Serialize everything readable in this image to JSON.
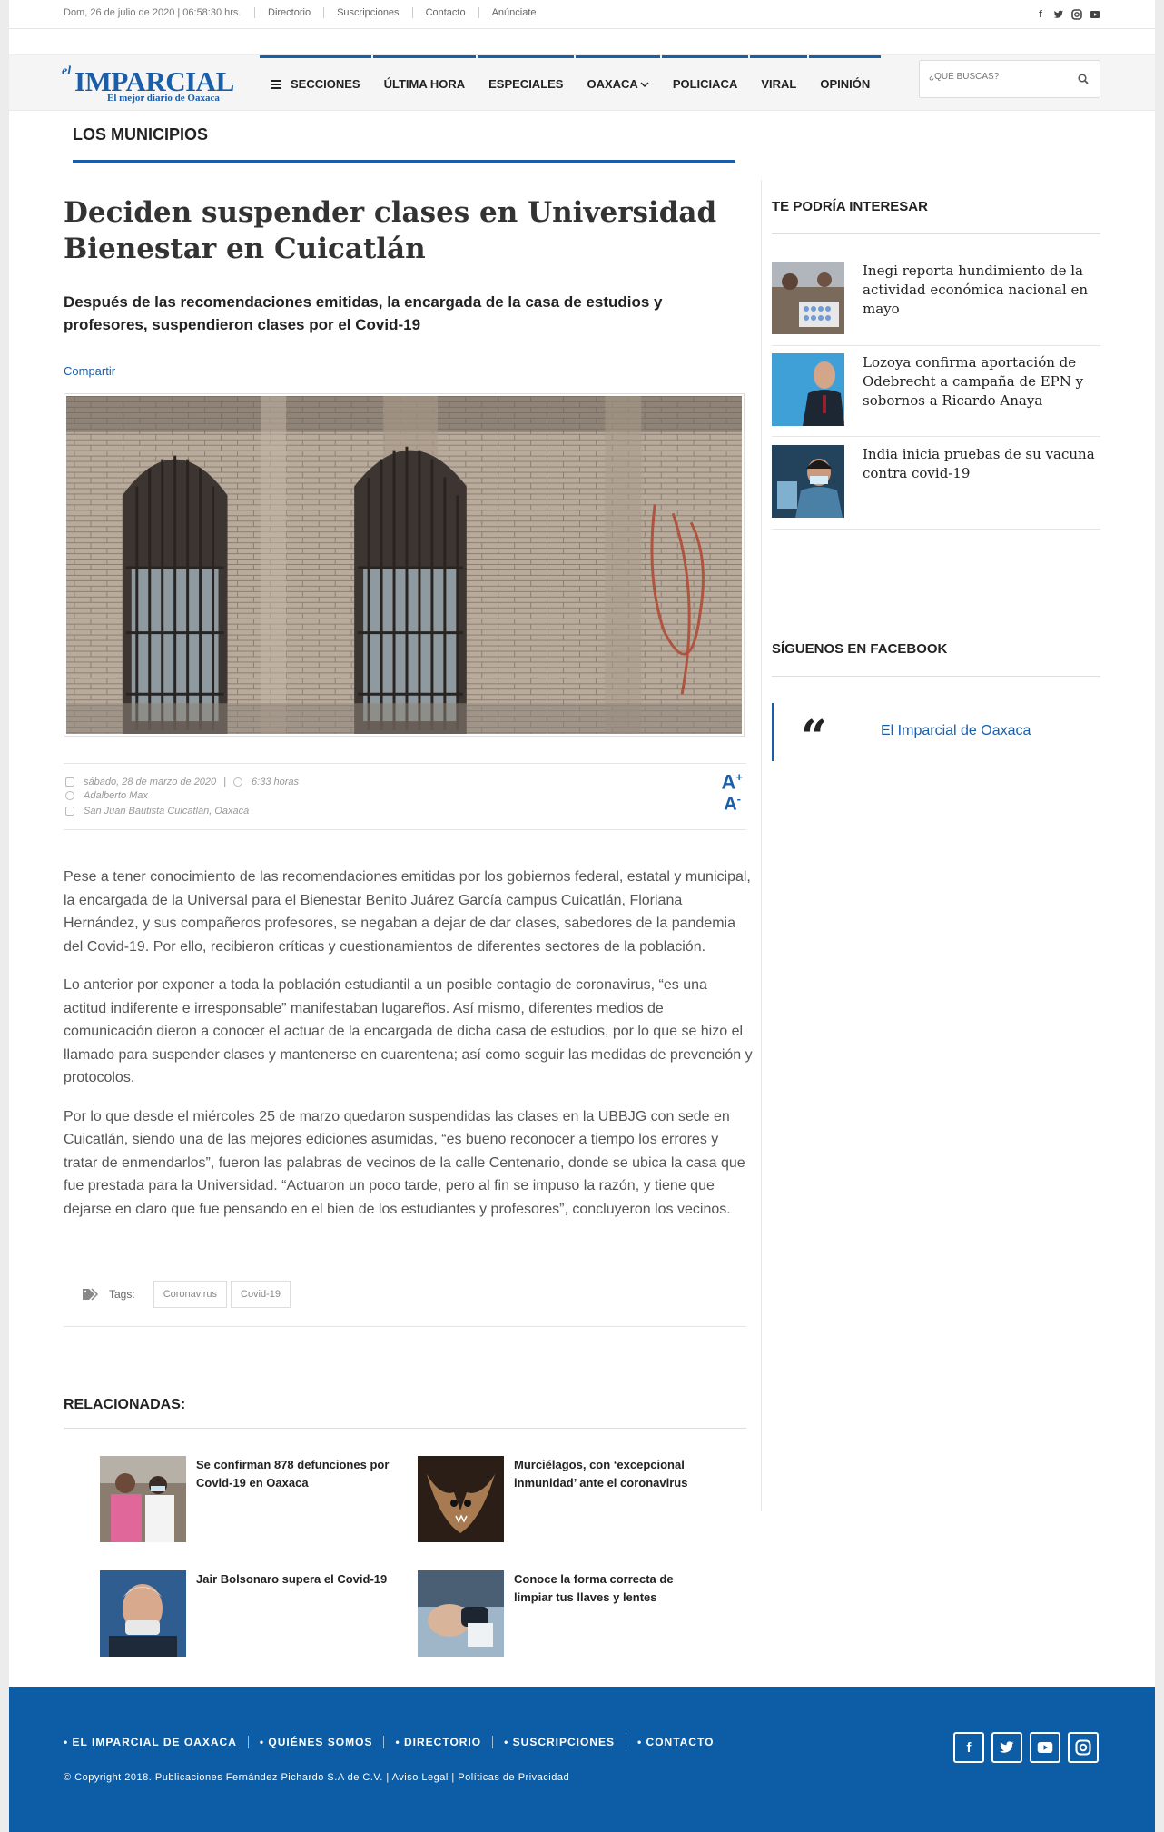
{
  "topbar": {
    "date": "Dom, 26 de julio de 2020 | 06:58:30 hrs.",
    "links": [
      "Directorio",
      "Suscripciones",
      "Contacto",
      "Anúnciate"
    ],
    "social": [
      "facebook-icon",
      "twitter-icon",
      "instagram-icon",
      "youtube-icon"
    ]
  },
  "header": {
    "logo_el": "el",
    "logo_name": "IMPARCIAL",
    "logo_tagline": "El mejor diario de Oaxaca",
    "nav": [
      "SECCIONES",
      "ÚLTIMA HORA",
      "ESPECIALES",
      "OAXACA",
      "POLICIACA",
      "VIRAL",
      "OPINIÓN"
    ],
    "search_placeholder": "¿QUÉ BUSCAS?"
  },
  "section": {
    "title": "LOS MUNICIPIOS"
  },
  "article": {
    "headline": "Deciden suspender clases en Universidad Bienestar en Cuicatlán",
    "subhead": "Después de las recomendaciones emitidas, la encargada de la casa de estudios y profesores, suspendieron clases por el Covid-19",
    "share": "Compartir",
    "date": "sábado, 28 de marzo de 2020",
    "time": "6:33 horas",
    "author": "Adalberto Max",
    "location": "San Juan Bautista Cuicatlán, Oaxaca",
    "font_up": "A",
    "font_down": "A",
    "paragraphs": [
      "Pese a tener conocimiento de las recomendaciones emitidas por los gobiernos federal, estatal y municipal, la encargada de la Universal para el Bienestar Benito Juárez García campus Cuicatlán, Floriana Hernández, y sus compañeros profesores, se negaban a dejar de dar clases, sabedores de la pandemia del Covid-19. Por ello, recibieron críticas y cuestionamientos de diferentes sectores de la población.",
      "Lo anterior por exponer a toda la población estudiantil a un posible contagio de coronavirus, “es una actitud indiferente e irresponsable” manifestaban lugareños. Así mismo, diferentes medios de comunicación dieron a conocer el actuar de la encargada de  dicha casa de estudios, por lo que se hizo el llamado para suspender clases y mantenerse en cuarentena; así como seguir las medidas de prevención y protocolos.",
      "Por lo que desde el miércoles 25 de marzo quedaron suspendidas las clases en la UBBJG con sede en Cuicatlán, siendo una de las mejores ediciones asumidas, “es bueno reconocer a tiempo los errores y tratar de enmendarlos”, fueron las palabras de vecinos de la calle Centenario, donde se ubica la casa que fue prestada para la Universidad. “Actuaron un poco tarde, pero al fin se impuso la razón, y tiene que dejarse en claro que fue pensando en el bien de los estudiantes y profesores”, concluyeron los vecinos."
    ],
    "tags_label": "Tags:",
    "tags": [
      "Coronavirus",
      "Covid-19"
    ]
  },
  "related": {
    "title": "RELACIONADAS:",
    "items": [
      "Se confirman 878 defunciones por Covid-19 en Oaxaca",
      "Murciélagos, con ‘excepcional inmunidad’ ante el coronavirus",
      "Jair Bolsonaro supera el Covid-19",
      "Conoce la forma correcta de limpiar tus llaves y lentes"
    ]
  },
  "sidebar": {
    "interest_title": "TE PODRÍA INTERESAR",
    "interest_items": [
      "Inegi reporta hundimiento de la actividad económica nacional en mayo",
      "Lozoya confirma aportación de Odebrecht a campaña de EPN y sobornos a Ricardo Anaya",
      "India inicia pruebas de su vacuna contra covid-19"
    ],
    "facebook_title": "SÍGUENOS EN FACEBOOK",
    "quote_mark": "“",
    "facebook_page": "El Imparcial de Oaxaca"
  },
  "footer": {
    "links": [
      "• EL IMPARCIAL DE OAXACA",
      "• QUIÉNES SOMOS",
      "• DIRECTORIO",
      "• SUSCRIPCIONES",
      "• CONTACTO"
    ],
    "copyright": "© Copyright 2018. Publicaciones Fernández Pichardo S.A de C.V. | Aviso Legal | Políticas de Privacidad",
    "social": [
      "facebook-icon",
      "twitter-icon",
      "youtube-icon",
      "instagram-icon"
    ]
  },
  "colors": {
    "brand": "#1b5ea8",
    "footer": "#0c5da5"
  }
}
